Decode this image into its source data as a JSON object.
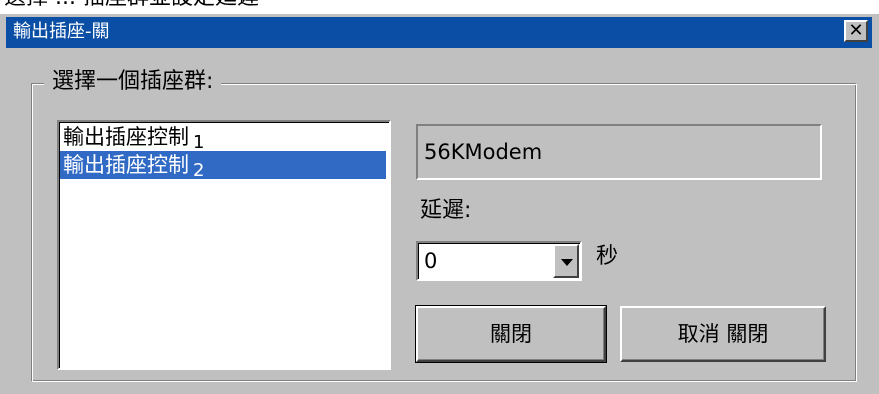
{
  "top_caption": "選擇 ... 插座群並設定延遲",
  "dialog": {
    "title": "輸出插座-關",
    "close_glyph": "✕"
  },
  "group": {
    "label": "選擇一個插座群:"
  },
  "outlet_list": {
    "items": [
      {
        "label": "輸出插座控制",
        "index": "1",
        "selected": false
      },
      {
        "label": "輸出插座控制",
        "index": "2",
        "selected": true
      }
    ]
  },
  "device_name": "56KModem",
  "delay": {
    "label": "延遲:",
    "value": "0",
    "unit": "秒"
  },
  "buttons": {
    "close": "關閉",
    "cancel": "取消 關閉"
  },
  "colors": {
    "titlebar": "#0a4fa5",
    "selection": "#316ac5",
    "face": "#c0c0c0"
  }
}
